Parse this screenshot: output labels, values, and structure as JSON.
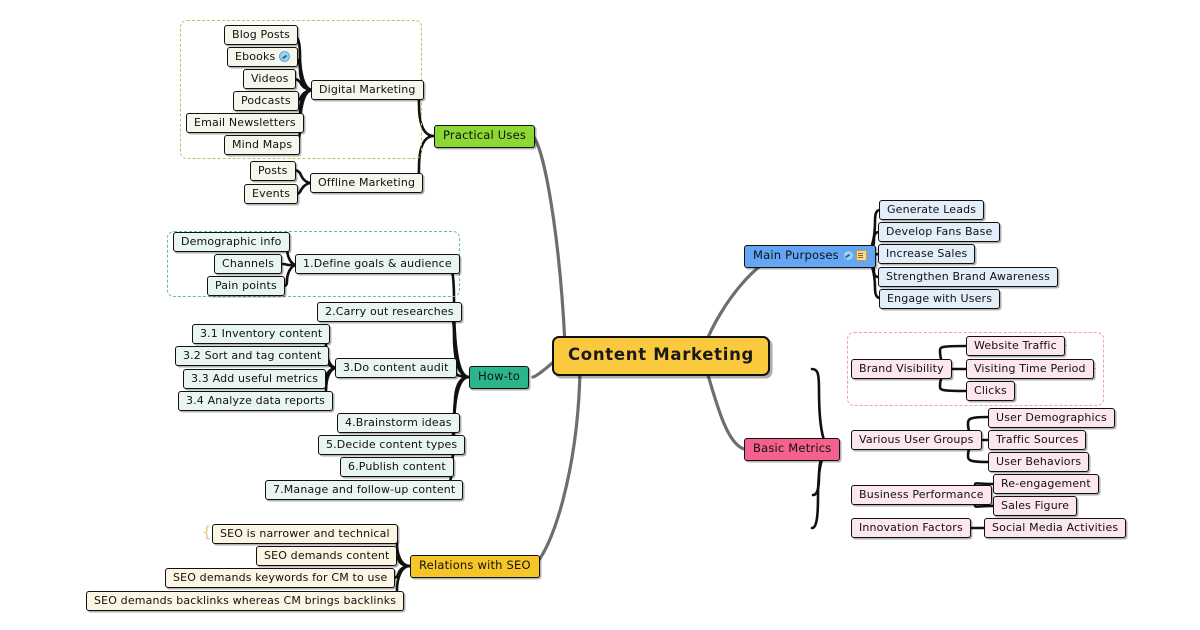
{
  "title": "Content Marketing Mind Map",
  "center": {
    "label": "Content Marketing",
    "color": "#FBC93D"
  },
  "colors": {
    "practical_uses": "#8CD834",
    "how_to": "#2BB58C",
    "relations_with_seo": "#F6C527",
    "main_purposes": "#63A6F5",
    "basic_metrics": "#F4618C",
    "center": "#FBC93D",
    "edge": "#6E6E6E",
    "boundary_olive": "#BFC45A",
    "boundary_teal": "#5BBFAE",
    "boundary_pink": "#F49BB5"
  },
  "branches": {
    "practical_uses": {
      "label": "Practical Uses",
      "children": [
        {
          "label": "Digital Marketing",
          "children": [
            {
              "label": "Blog Posts"
            },
            {
              "label": "Ebooks",
              "icons": [
                "link-icon"
              ]
            },
            {
              "label": "Videos"
            },
            {
              "label": "Podcasts"
            },
            {
              "label": "Email Newsletters"
            },
            {
              "label": "Mind Maps"
            }
          ]
        },
        {
          "label": "Offline Marketing",
          "children": [
            {
              "label": "Posts"
            },
            {
              "label": "Events"
            }
          ]
        }
      ]
    },
    "how_to": {
      "label": "How-to",
      "children": [
        {
          "label": "1.Define goals & audience",
          "children": [
            {
              "label": "Demographic info"
            },
            {
              "label": "Channels"
            },
            {
              "label": "Pain points"
            }
          ]
        },
        {
          "label": "2.Carry out researches",
          "children": []
        },
        {
          "label": "3.Do content audit",
          "children": [
            {
              "label": "3.1 Inventory content"
            },
            {
              "label": "3.2 Sort and tag content"
            },
            {
              "label": "3.3 Add useful metrics"
            },
            {
              "label": "3.4 Analyze data reports"
            }
          ]
        },
        {
          "label": "4.Brainstorm ideas",
          "children": []
        },
        {
          "label": "5.Decide content types",
          "children": []
        },
        {
          "label": "6.Publish content",
          "children": []
        },
        {
          "label": "7.Manage and follow-up content",
          "children": []
        }
      ]
    },
    "relations_with_seo": {
      "label": "Relations with SEO",
      "children": [
        {
          "label": "SEO is narrower and technical"
        },
        {
          "label": "SEO demands content"
        },
        {
          "label": "SEO demands keywords for CM to use"
        },
        {
          "label": "SEO demands backlinks whereas CM brings backlinks"
        }
      ]
    },
    "main_purposes": {
      "label": "Main Purposes",
      "icons": [
        "link-icon",
        "note-icon"
      ],
      "children": [
        {
          "label": "Generate Leads"
        },
        {
          "label": "Develop Fans Base"
        },
        {
          "label": "Increase Sales"
        },
        {
          "label": "Strengthen Brand Awareness"
        },
        {
          "label": "Engage with Users"
        }
      ]
    },
    "basic_metrics": {
      "label": "Basic Metrics",
      "children": [
        {
          "label": "Brand Visibility",
          "children": [
            {
              "label": "Website Traffic"
            },
            {
              "label": "Visiting Time Period"
            },
            {
              "label": "Clicks"
            }
          ]
        },
        {
          "label": "Various User Groups",
          "children": [
            {
              "label": "User Demographics"
            },
            {
              "label": "Traffic Sources"
            },
            {
              "label": "User Behaviors"
            }
          ]
        },
        {
          "label": "Business Performance",
          "children": [
            {
              "label": "Re-engagement"
            },
            {
              "label": "Sales Figure"
            }
          ]
        },
        {
          "label": "Innovation Factors",
          "children": [
            {
              "label": "Social Media Activities"
            }
          ]
        }
      ]
    }
  }
}
